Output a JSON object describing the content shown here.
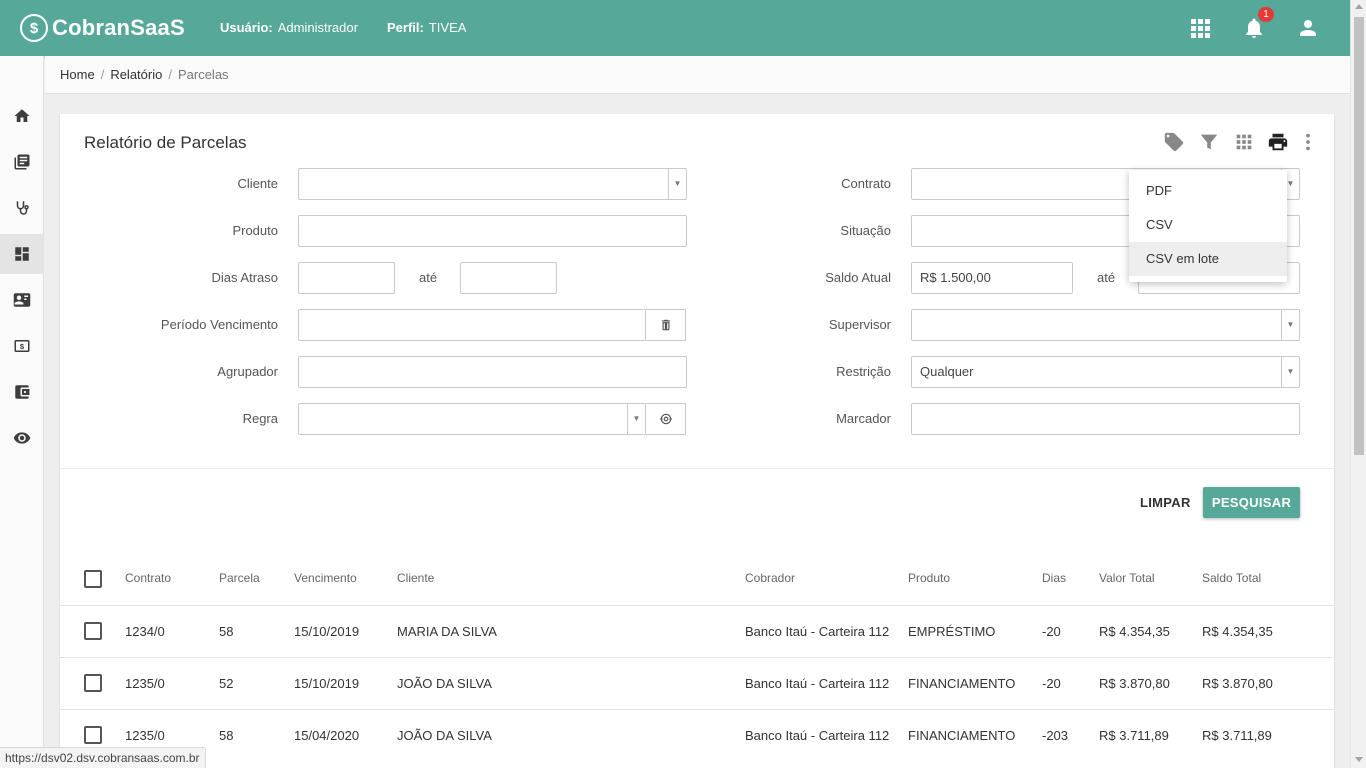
{
  "app": {
    "logo_text": "CobranSaaS",
    "logo_mark": "$"
  },
  "header": {
    "user_label": "Usuário:",
    "user_value": "Administrador",
    "profile_label": "Perfil:",
    "profile_value": "TIVEA",
    "notifications_count": "1",
    "icons": [
      "apps-grid-icon",
      "bell-icon",
      "account-icon"
    ]
  },
  "sidebar": {
    "items": [
      {
        "icon": "home-icon"
      },
      {
        "icon": "library-books-icon"
      },
      {
        "icon": "stethoscope-icon"
      },
      {
        "icon": "dashboard-icon",
        "active": true
      },
      {
        "icon": "contact-card-icon"
      },
      {
        "icon": "money-icon"
      },
      {
        "icon": "wallet-icon"
      },
      {
        "icon": "eye-icon"
      }
    ]
  },
  "breadcrumb": {
    "home": "Home",
    "report": "Relatório",
    "current": "Parcelas"
  },
  "page": {
    "title": "Relatório de Parcelas",
    "toolbar_icons": [
      "tag-icon",
      "filter-icon",
      "grid-icon",
      "print-icon",
      "more-vert-icon"
    ]
  },
  "filters": {
    "cliente": "Cliente",
    "produto": "Produto",
    "dias_atraso": "Dias Atraso",
    "ate": "até",
    "periodo_vencimento": "Período Vencimento",
    "agrupador": "Agrupador",
    "regra": "Regra",
    "contrato": "Contrato",
    "situacao": "Situação",
    "saldo_atual": "Saldo Atual",
    "saldo_atual_value": "R$ 1.500,00",
    "supervisor": "Supervisor",
    "restricao": "Restrição",
    "restricao_value": "Qualquer",
    "marcador": "Marcador"
  },
  "actions": {
    "clear": "LIMPAR",
    "search": "PESQUISAR"
  },
  "export_menu": {
    "items": [
      "PDF",
      "CSV",
      "CSV em lote"
    ],
    "highlighted": 2
  },
  "table": {
    "columns": [
      "Contrato",
      "Parcela",
      "Vencimento",
      "Cliente",
      "Cobrador",
      "Produto",
      "Dias",
      "Valor Total",
      "Saldo Total"
    ],
    "rows": [
      {
        "contrato": "1234/0",
        "parcela": "58",
        "vencimento": "15/10/2019",
        "cliente": "MARIA DA SILVA",
        "cobrador": "Banco Itaú - Carteira 112",
        "produto": "EMPRÉSTIMO",
        "dias": "-20",
        "valor_total": "R$ 4.354,35",
        "saldo_total": "R$ 4.354,35"
      },
      {
        "contrato": "1235/0",
        "parcela": "52",
        "vencimento": "15/10/2019",
        "cliente": "JOÃO DA SILVA",
        "cobrador": "Banco Itaú - Carteira 112",
        "produto": "FINANCIAMENTO",
        "dias": "-20",
        "valor_total": "R$ 3.870,80",
        "saldo_total": "R$ 3.870,80"
      },
      {
        "contrato": "1235/0",
        "parcela": "58",
        "vencimento": "15/04/2020",
        "cliente": "JOÃO DA SILVA",
        "cobrador": "Banco Itaú - Carteira 112",
        "produto": "FINANCIAMENTO",
        "dias": "-203",
        "valor_total": "R$ 3.711,89",
        "saldo_total": "R$ 3.711,89"
      }
    ]
  },
  "status_bar": {
    "url": "https://dsv02.dsv.cobransaas.com.br"
  },
  "colors": {
    "primary": "#56a898",
    "badge": "#e53935",
    "sidebar_active": "#e4e4e4"
  }
}
